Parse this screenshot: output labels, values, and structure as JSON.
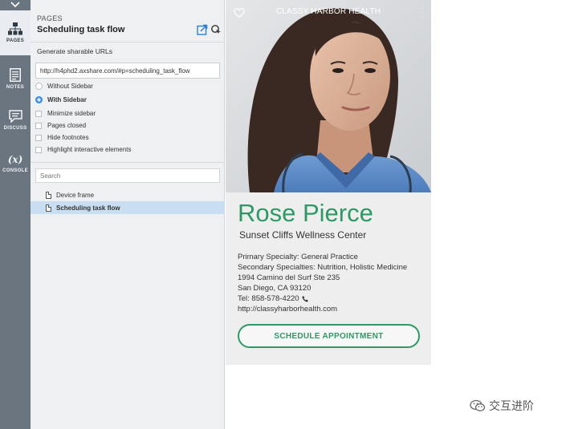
{
  "rail": {
    "items": [
      {
        "label": "PAGES",
        "icon": "sitemap-icon"
      },
      {
        "label": "NOTES",
        "icon": "notes-icon"
      },
      {
        "label": "DISCUSS",
        "icon": "discuss-icon"
      },
      {
        "label": "CONSOLE",
        "icon": "console-icon"
      }
    ],
    "console_glyph": "(x)"
  },
  "pages_panel": {
    "label": "PAGES",
    "title": "Scheduling task flow",
    "share_label": "Generate sharable URLs",
    "url": "http://h4phd2.axshare.com/#p=scheduling_task_flow",
    "options": [
      {
        "label": "Without Sidebar",
        "type": "radio",
        "checked": false
      },
      {
        "label": "With Sidebar",
        "type": "radio",
        "checked": true
      },
      {
        "label": "Minimize sidebar",
        "type": "checkbox",
        "checked": false
      },
      {
        "label": "Pages closed",
        "type": "checkbox",
        "checked": false
      },
      {
        "label": "Hide footnotes",
        "type": "checkbox",
        "checked": false
      },
      {
        "label": "Highlight interactive elements",
        "type": "checkbox",
        "checked": false
      }
    ],
    "search_placeholder": "Search",
    "pages": [
      {
        "label": "Device frame",
        "selected": false
      },
      {
        "label": "Scheduling task flow",
        "selected": true
      }
    ]
  },
  "card": {
    "brand": "CLASSY HARBOR HEALTH",
    "name": "Rose Pierce",
    "clinic": "Sunset Cliffs Wellness Center",
    "primary": "Primary Specialty: General Practice",
    "secondary": "Secondary Specialties: Nutrition, Holistic Medicine",
    "address1": "1994 Camino del Surf Ste 235",
    "address2": "San Diego, CA 93120",
    "tel": "Tel: 858-578-4220",
    "url": "http://classyharborhealth.com",
    "button": "SCHEDULE APPOINTMENT"
  },
  "watermark": "交互进阶",
  "colors": {
    "accent_green": "#2d9a66",
    "selection_blue": "#c9def1",
    "rail_gray": "#6b7580"
  }
}
